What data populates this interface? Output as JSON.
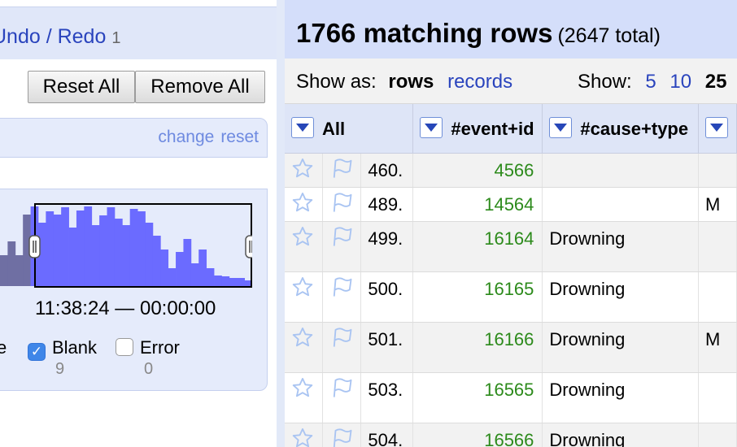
{
  "history": {
    "undo_redo_label": "Undo / Redo",
    "count": "1"
  },
  "facet_panel": {
    "reset_all": "Reset All",
    "remove_all": "Remove All",
    "facet": {
      "change_link": "change",
      "reset_link": "reset",
      "range_label": "11:38:24 — 00:00:00",
      "choices": [
        {
          "label": "e",
          "count": ""
        },
        {
          "label": "Blank",
          "checked": true,
          "count": "9"
        },
        {
          "label": "Error",
          "checked": false,
          "count": "0"
        }
      ],
      "histogram": {
        "excluded_color": "#6f6fa3",
        "selected_color": "#6b6bff",
        "relative_values": [
          0.38,
          0.55,
          0.38,
          0.88,
          0.98,
          0.78,
          0.92,
          0.88,
          0.97,
          0.72,
          0.93,
          0.98,
          0.75,
          0.87,
          0.97,
          0.83,
          0.75,
          0.95,
          0.92,
          0.78,
          0.62,
          0.45,
          0.22,
          0.42,
          0.58,
          0.28,
          0.45,
          0.22,
          0.13,
          0.12,
          0.1,
          0.1,
          0.07
        ]
      }
    }
  },
  "summary": {
    "matching": "1766 matching rows",
    "total": "(2647 total)"
  },
  "view_bar": {
    "show_as_label": "Show as:",
    "rows_label": "rows",
    "records_label": "records",
    "show_label": "Show:",
    "page_sizes": [
      "5",
      "10",
      "25"
    ],
    "current_page_size": "25"
  },
  "table": {
    "columns": [
      "All",
      "#event+id",
      "#cause+type",
      ""
    ],
    "rows": [
      {
        "index": "460.",
        "event_id": "4566",
        "cause_type": "",
        "extra": ""
      },
      {
        "index": "489.",
        "event_id": "14564",
        "cause_type": "",
        "extra": "M"
      },
      {
        "index": "499.",
        "event_id": "16164",
        "cause_type": "Drowning",
        "extra": ""
      },
      {
        "index": "500.",
        "event_id": "16165",
        "cause_type": "Drowning",
        "extra": ""
      },
      {
        "index": "501.",
        "event_id": "16166",
        "cause_type": "Drowning",
        "extra": "M"
      },
      {
        "index": "503.",
        "event_id": "16565",
        "cause_type": "Drowning",
        "extra": ""
      },
      {
        "index": "504.",
        "event_id": "16566",
        "cause_type": "Drowning",
        "extra": ""
      }
    ]
  },
  "icons": {
    "star": "star-icon",
    "flag": "flag-icon",
    "menu": "dropdown-arrow-icon",
    "check": "checkmark-icon"
  },
  "colors": {
    "link": "#2a44bd",
    "facet_link": "#6e8ae0",
    "id_green": "#2c8a1b",
    "header_bg": "#d4defa"
  }
}
